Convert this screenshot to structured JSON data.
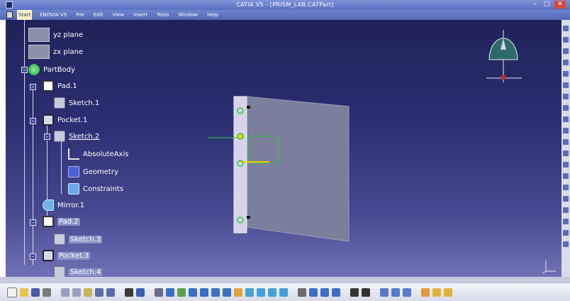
{
  "window": {
    "title": "CATIA V5 - [PRISM_LAB.CATPart]",
    "minimize": "–",
    "maximize": "□",
    "close": "✕"
  },
  "menu": {
    "items": [
      "Start",
      "ENOVIA V5",
      "File",
      "Edit",
      "View",
      "Insert",
      "Tools",
      "Window",
      "Help"
    ]
  },
  "tree": {
    "yz_plane": "yz plane",
    "zx_plane": "zx plane",
    "partbody": "PartBody",
    "pad1": "Pad.1",
    "sketch1": "Sketch.1",
    "pocket1": "Pocket.1",
    "sketch2": "Sketch.2",
    "absolute_axis": "AbsoluteAxis",
    "geometry": "Geometry",
    "constraints": "Constraints",
    "mirror1": "Mirror.1",
    "pad2": "Pad.2",
    "sketch3": "Sketch.3",
    "pocket3": "Pocket.3",
    "sketch4": "Sketch.4"
  },
  "colors": {
    "viewport_top": "#1f2358",
    "viewport_bottom": "#7072b5",
    "highlight": "#8a92c8",
    "sketch_green": "#2ecc40",
    "constraint_yellow": "#f0d000"
  },
  "icons": {
    "compass": "compass-icon",
    "triad": "axis-triad-icon"
  }
}
